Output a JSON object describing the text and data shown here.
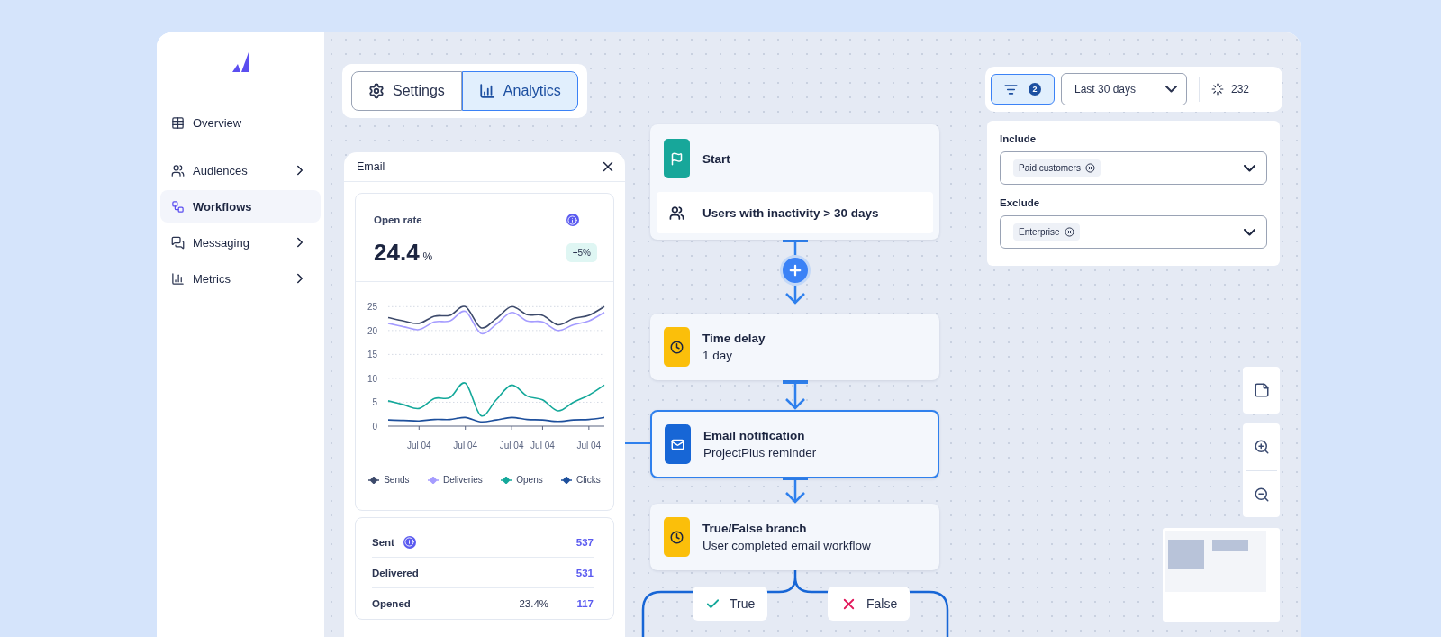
{
  "sidebar": {
    "items": [
      {
        "label": "Overview",
        "selected": false,
        "expandable": false
      },
      {
        "label": "Audiences",
        "selected": false,
        "expandable": true
      },
      {
        "label": "Workflows",
        "selected": true,
        "expandable": false
      },
      {
        "label": "Messaging",
        "selected": false,
        "expandable": true
      },
      {
        "label": "Metrics",
        "selected": false,
        "expandable": true
      }
    ]
  },
  "view_tabs": [
    {
      "label": "Settings",
      "selected": false
    },
    {
      "label": "Analytics",
      "selected": true
    }
  ],
  "email_panel": {
    "title": "Email",
    "metric": {
      "label": "Open rate",
      "value": "24.4",
      "unit": "%",
      "change": "+5%"
    },
    "chart_data": {
      "type": "line",
      "categories": [
        null,
        null,
        "Jul 04",
        null,
        null,
        "Jul 04",
        null,
        null,
        "Jul 04",
        null,
        "Jul 04",
        null,
        null,
        "Jul 04",
        null
      ],
      "grid": true,
      "ylim": [
        0,
        25
      ],
      "yticks": [
        0,
        5,
        10,
        15,
        20,
        25
      ],
      "series": [
        {
          "name": "Sends",
          "color": "#3d4a6b",
          "values": [
            22.7,
            22,
            21.5,
            23,
            23.2,
            25,
            20.6,
            22.5,
            25,
            23.3,
            23.2,
            21.2,
            22.5,
            23.2,
            25
          ]
        },
        {
          "name": "Deliveries",
          "color": "#a59cff",
          "values": [
            21.5,
            20.8,
            20.2,
            21.8,
            22,
            24,
            19.4,
            21.3,
            23.8,
            22,
            21.8,
            20,
            21.2,
            22,
            23.8
          ]
        },
        {
          "name": "Opens",
          "color": "#14a89a",
          "values": [
            5.3,
            4.5,
            3.7,
            5.8,
            6,
            9,
            2.2,
            5.5,
            8.6,
            6.3,
            5.5,
            3.2,
            5,
            6.5,
            8.6
          ]
        },
        {
          "name": "Clicks",
          "color": "#1d4f9c",
          "values": [
            1.3,
            1.2,
            1.1,
            1.4,
            1.4,
            1.8,
            0.9,
            1.3,
            1.8,
            1.4,
            1.3,
            1,
            1.3,
            1.4,
            1.8
          ]
        }
      ]
    },
    "stats": [
      {
        "label": "Sent",
        "info": true,
        "count": "537"
      },
      {
        "label": "Delivered",
        "info": false,
        "count": "531"
      },
      {
        "label": "Opened",
        "info": false,
        "share": "23.4%",
        "count": "117"
      }
    ]
  },
  "workflow": {
    "nodes": [
      {
        "kind": "start",
        "title": "Start",
        "condition": "Users with inactivity > 30 days",
        "selected": false
      },
      {
        "kind": "delay",
        "title": "Time delay",
        "detail": "1 day",
        "selected": false
      },
      {
        "kind": "email",
        "title": "Email notification",
        "detail": "ProjectPlus reminder",
        "selected": true
      },
      {
        "kind": "branch",
        "title": "True/False branch",
        "detail": "User completed email workflow",
        "selected": false
      }
    ],
    "branches": [
      {
        "kind": "true",
        "label": "True"
      },
      {
        "kind": "false",
        "label": "False"
      }
    ]
  },
  "filters": {
    "active": true,
    "count": "2",
    "period": "Last 30 days",
    "total": "232",
    "groups": [
      {
        "label": "Include",
        "tags": [
          "Paid customers"
        ]
      },
      {
        "label": "Exclude",
        "tags": [
          "Enterprise"
        ]
      }
    ]
  }
}
